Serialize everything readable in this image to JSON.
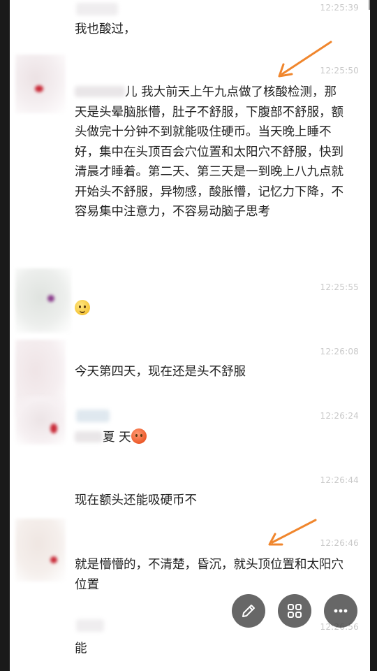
{
  "messages": [
    {
      "time": "12:25:39",
      "text": "我也酸过，"
    },
    {
      "time": "12:25:50",
      "name_tail": "儿",
      "text": " 我大前天上午九点做了核酸检测，那天是头晕脑胀懵，肚子不舒服，下腹部不舒服，额头做完十分钟不到就能吸住硬币。当天晚上睡不好，集中在头顶百会穴位置和太阳穴不舒服，快到清晨才睡着。第二天、第三天是一到晚上八九点就开始头不舒服，异物感，酸胀懵，记忆力下降，不容易集中注意力，不容易动脑子思考"
    },
    {
      "time": "12:25:55",
      "emoji": "😇"
    },
    {
      "time": "12:26:08",
      "text": "今天第四天，现在还是头不舒服"
    },
    {
      "time": "12:26:24",
      "text": "夏 天",
      "emoji": "😡"
    },
    {
      "time": "12:26:44",
      "text": "现在额头还能吸硬币不"
    },
    {
      "time": "12:26:46",
      "text": "就是懵懵的，不清楚，昏沉，就头顶位置和太阳穴位置"
    },
    {
      "time": "12:26:56",
      "text": "能"
    }
  ],
  "colors": {
    "arrow": "#f0862d",
    "timestamp": "#c9c9c9",
    "text": "#222222"
  },
  "fab_icons": [
    "pencil-icon",
    "grid-icon",
    "more-icon"
  ]
}
